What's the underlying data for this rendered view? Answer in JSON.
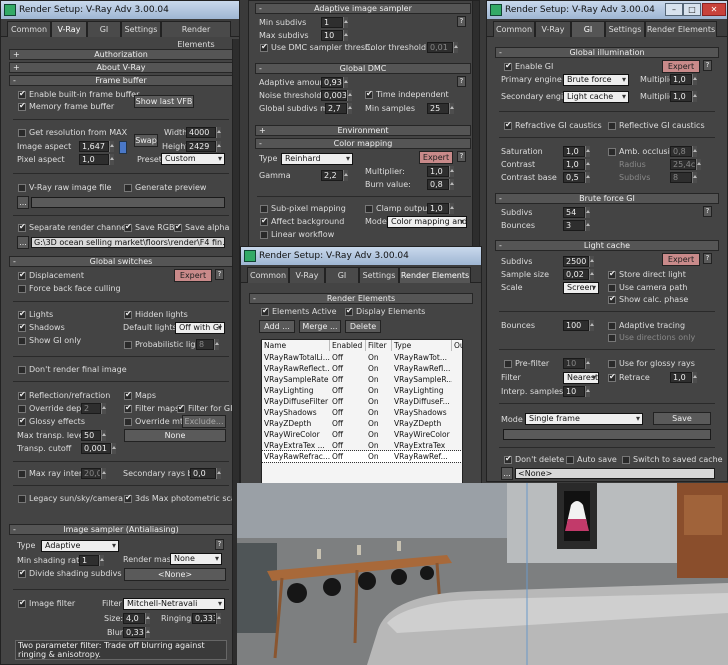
{
  "win1": {
    "title": "Render Setup: V-Ray Adv 3.00.04",
    "tabs": [
      "Common",
      "V-Ray",
      "GI",
      "Settings",
      "Render Elements"
    ],
    "rollouts": {
      "authorization": "Authorization",
      "about": "About V-Ray",
      "frame_buffer": "Frame buffer",
      "global_switches": "Global switches",
      "image_sampler": "Image sampler (Antialiasing)"
    },
    "frame_buffer": {
      "enable_vfb": "Enable built-in frame buffer",
      "memory_fb": "Memory frame buffer",
      "show_last_vfb": "Show last VFB",
      "get_res": "Get resolution from MAX",
      "swap": "Swap",
      "width_label": "Width",
      "width": "4000",
      "height_label": "Height",
      "height": "2429",
      "image_aspect_label": "Image aspect",
      "image_aspect": "1,647",
      "pixel_aspect_label": "Pixel aspect",
      "pixel_aspect": "1,0",
      "lock_icon": "L",
      "preset_label": "Preset",
      "preset": "Custom",
      "raw_image": "V-Ray raw image file",
      "gen_preview": "Generate preview",
      "raw_path_btn": "...",
      "sep_channels": "Separate render channels",
      "save_rgb": "Save RGB",
      "save_alpha": "Save alpha",
      "path": "G:\\3D ocean selling market\\floors\\render\\F4 fin.png"
    },
    "global_switches": {
      "displacement": "Displacement",
      "expert": "Expert",
      "q": "?",
      "force_back": "Force back face culling",
      "lights": "Lights",
      "hidden_lights": "Hidden lights",
      "shadows": "Shadows",
      "default_lights_label": "Default lights",
      "default_lights": "Off with GI",
      "show_gi_only": "Show GI only",
      "prob_lights": "Probabilistic lights",
      "prob_lights_val": "8",
      "dont_render": "Don't render final image",
      "refl_refr": "Reflection/refraction",
      "maps": "Maps",
      "override_depth": "Override depth",
      "override_depth_val": "2",
      "filter_maps": "Filter maps",
      "filter_gi": "Filter for GI",
      "glossy": "Glossy effects",
      "override_mtl": "Override mtl",
      "exclude": "Exclude...",
      "max_transp_label": "Max transp. levels",
      "max_transp": "50",
      "none_btn": "None",
      "transp_cutoff_label": "Transp. cutoff",
      "transp_cutoff": "0,001",
      "max_ray": "Max ray intens",
      "max_ray_val": "20,0",
      "sec_rays_label": "Secondary rays bias",
      "sec_rays": "0,0",
      "legacy_sun": "Legacy sun/sky/camera",
      "photometric": "3ds Max photometric scale"
    },
    "image_sampler": {
      "type_label": "Type",
      "type": "Adaptive",
      "q": "?",
      "min_shading_label": "Min shading rate",
      "min_shading": "1",
      "render_mask_label": "Render mask",
      "render_mask": "None",
      "divide_shading": "Divide shading subdivs",
      "none_btn": "<None>",
      "image_filter": "Image filter",
      "filter_label": "Filter",
      "filter": "Mitchell-Netravali",
      "size_label": "Size:",
      "size": "4,0",
      "ringing_label": "Ringing:",
      "ringing": "0,333",
      "blur_label": "Blur:",
      "blur": "0,333",
      "desc": "Two parameter filter: Trade off blurring against ringing & anisotropy."
    }
  },
  "win2": {
    "adaptive_rollout": "Adaptive image sampler",
    "min_subdivs_label": "Min subdivs",
    "min_subdivs": "1",
    "max_subdivs_label": "Max subdivs",
    "max_subdivs": "10",
    "use_dmc": "Use DMC sampler thresh.",
    "color_threshold_label": "Color threshold",
    "color_threshold": "0,01",
    "global_dmc_rollout": "Global DMC",
    "adaptive_amount_label": "Adaptive amount",
    "adaptive_amount": "0,93",
    "noise_threshold_label": "Noise threshold",
    "noise_threshold": "0,003",
    "time_independent": "Time independent",
    "global_subdivs_label": "Global subdivs mult.",
    "global_subdivs": "2,7",
    "min_samples_label": "Min samples",
    "min_samples": "25",
    "environment_rollout": "Environment",
    "color_mapping_rollout": "Color mapping",
    "cm_type_label": "Type",
    "cm_type": "Reinhard",
    "expert": "Expert",
    "q": "?",
    "multiplier_label": "Multiplier:",
    "multiplier": "1,0",
    "gamma_label": "Gamma",
    "gamma": "2,2",
    "burn_label": "Burn value:",
    "burn": "0,8",
    "subpixel": "Sub-pixel mapping",
    "clamp": "Clamp output",
    "clamp_val": "1,0",
    "affect_bg": "Affect background",
    "mode_label": "Mode",
    "mode": "Color mapping and gamma",
    "linear": "Linear workflow"
  },
  "win3": {
    "title": "Render Setup: V-Ray Adv 3.00.04",
    "tabs": [
      "Common",
      "V-Ray",
      "GI",
      "Settings",
      "Render Elements"
    ],
    "rollout": "Render Elements",
    "elements_active": "Elements Active",
    "display_elements": "Display Elements",
    "add": "Add ...",
    "merge": "Merge ...",
    "delete": "Delete",
    "columns": [
      "Name",
      "Enabled",
      "Filter",
      "Type",
      "Ou"
    ],
    "rows": [
      [
        "VRayRawTotalLi...",
        "Off",
        "On",
        "VRayRawTot..."
      ],
      [
        "VRayRawReflect...",
        "Off",
        "On",
        "VRayRawRefl..."
      ],
      [
        "VRaySampleRate",
        "Off",
        "On",
        "VRaySampleR..."
      ],
      [
        "VRayLighting",
        "Off",
        "On",
        "VRayLighting"
      ],
      [
        "VRayDiffuseFilter",
        "Off",
        "On",
        "VRayDiffuseF..."
      ],
      [
        "VRayShadows",
        "Off",
        "On",
        "VRayShadows"
      ],
      [
        "VRayZDepth",
        "Off",
        "On",
        "VRayZDepth"
      ],
      [
        "VRayWireColor",
        "Off",
        "On",
        "VRayWireColor"
      ],
      [
        "VRayExtraTex ...",
        "Off",
        "On",
        "VRayExtraTex"
      ],
      [
        "VRayRawRefrac...",
        "Off",
        "On",
        "VRayRawRef..."
      ]
    ]
  },
  "win4": {
    "title": "Render Setup: V-Ray Adv 3.00.04",
    "tabs": [
      "Common",
      "V-Ray",
      "GI",
      "Settings",
      "Render Elements"
    ],
    "gi_rollout": "Global illumination",
    "enable_gi": "Enable GI",
    "expert": "Expert",
    "q": "?",
    "primary_label": "Primary engine",
    "primary": "Brute force",
    "multiplier_label": "Multiplier",
    "primary_mult": "1,0",
    "secondary_label": "Secondary engine",
    "secondary": "Light cache",
    "secondary_mult": "1,0",
    "refr_caustics": "Refractive GI caustics",
    "refl_caustics": "Reflective GI caustics",
    "saturation_label": "Saturation",
    "saturation": "1,0",
    "amb_occl": "Amb. occlusion",
    "amb_occl_val": "0,8",
    "contrast_label": "Contrast",
    "contrast": "1,0",
    "radius_label": "Radius",
    "radius": "25,4cm",
    "contrast_base_label": "Contrast base",
    "contrast_base": "0,5",
    "subdivs_label": "Subdivs",
    "ao_subdivs": "8",
    "bf_rollout": "Brute force GI",
    "bf_subdivs_label": "Subdivs",
    "bf_subdivs": "54",
    "bounces_label": "Bounces",
    "bounces": "3",
    "lc_rollout": "Light cache",
    "lc_subdivs_label": "Subdivs",
    "lc_subdivs": "2500",
    "sample_size_label": "Sample size",
    "sample_size": "0,02",
    "store_direct": "Store direct light",
    "scale_label": "Scale",
    "scale": "Screen",
    "use_camera": "Use camera path",
    "show_calc": "Show calc. phase",
    "lc_bounces_label": "Bounces",
    "lc_bounces": "100",
    "adaptive_tracing": "Adaptive tracing",
    "use_directions": "Use directions only",
    "prefilter": "Pre-filter",
    "prefilter_val": "10",
    "glossy_rays": "Use for glossy rays",
    "filter_label": "Filter",
    "filter": "Nearest",
    "retrace": "Retrace",
    "retrace_val": "1,0",
    "interp_label": "Interp. samples",
    "interp": "10",
    "mode_label": "Mode",
    "mode": "Single frame",
    "save": "Save",
    "dont_delete": "Don't delete",
    "auto_save": "Auto save",
    "switch_saved": "Switch to saved cache",
    "none_path": "<None>",
    "path_btn": "..."
  },
  "colors": {
    "panel": "#444444",
    "title": "#b3c7e0",
    "expert": "#c98a8a"
  }
}
